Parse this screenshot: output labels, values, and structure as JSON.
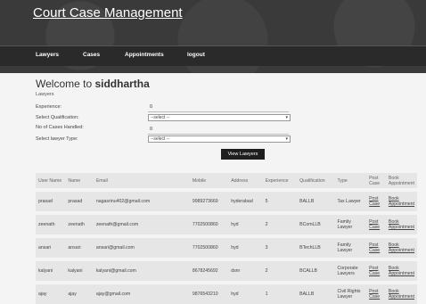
{
  "app": {
    "title": "Court Case Management"
  },
  "nav": [
    "Lawyers",
    "Cases",
    "Appointments",
    "logout"
  ],
  "welcome": {
    "prefix": "Welcome to ",
    "name": "siddhartha"
  },
  "form": {
    "section": "Lawyers",
    "experience_label": "Experience:",
    "experience_value": "0",
    "qualification_label": "Select Qualification:",
    "qualification_value": "--select --",
    "cases_label": "No of Cases Handled:",
    "cases_value": "0",
    "type_label": "Select lawyer Type:",
    "type_value": "--select --",
    "button": "View Lawyers"
  },
  "table": {
    "headers": [
      "User Name",
      "Name",
      "Email",
      "Mobile",
      "Address",
      "Experience",
      "Qualification",
      "Type",
      "Post Case",
      "Book Appointment"
    ],
    "rows": [
      [
        "prasad",
        "prasad",
        "nagasrinu402@gmail.com",
        "9989273669",
        "hyderabad",
        "5",
        "BALLB",
        "Tax Lawyer",
        "Post Case",
        "Book Appointment"
      ],
      [
        "zeenath",
        "zeenath",
        "zeenath@gmail.com",
        "7702500860",
        "hyd",
        "2",
        "BComLLB",
        "Family Lawyer",
        "Post Case",
        "Book Appointment"
      ],
      [
        "ansari",
        "ansari",
        "ansari@gmail.com",
        "7702500860",
        "hyd",
        "3",
        "BTechLLB",
        "Family Lawyer",
        "Post Case",
        "Book Appointment"
      ],
      [
        "kalyani",
        "kalyani",
        "kalyani@gmail.com",
        "8678245692",
        "dsnr",
        "2",
        "BCALLB",
        "Corporate Lawyers",
        "Post Case",
        "Book Appointment"
      ],
      [
        "ajay",
        "ajay",
        "ajay@gmail.com",
        "9876543210",
        "hyd",
        "1",
        "BALLB",
        "Civil Rights Lawyer",
        "Post Case",
        "Book Appointment"
      ]
    ]
  }
}
